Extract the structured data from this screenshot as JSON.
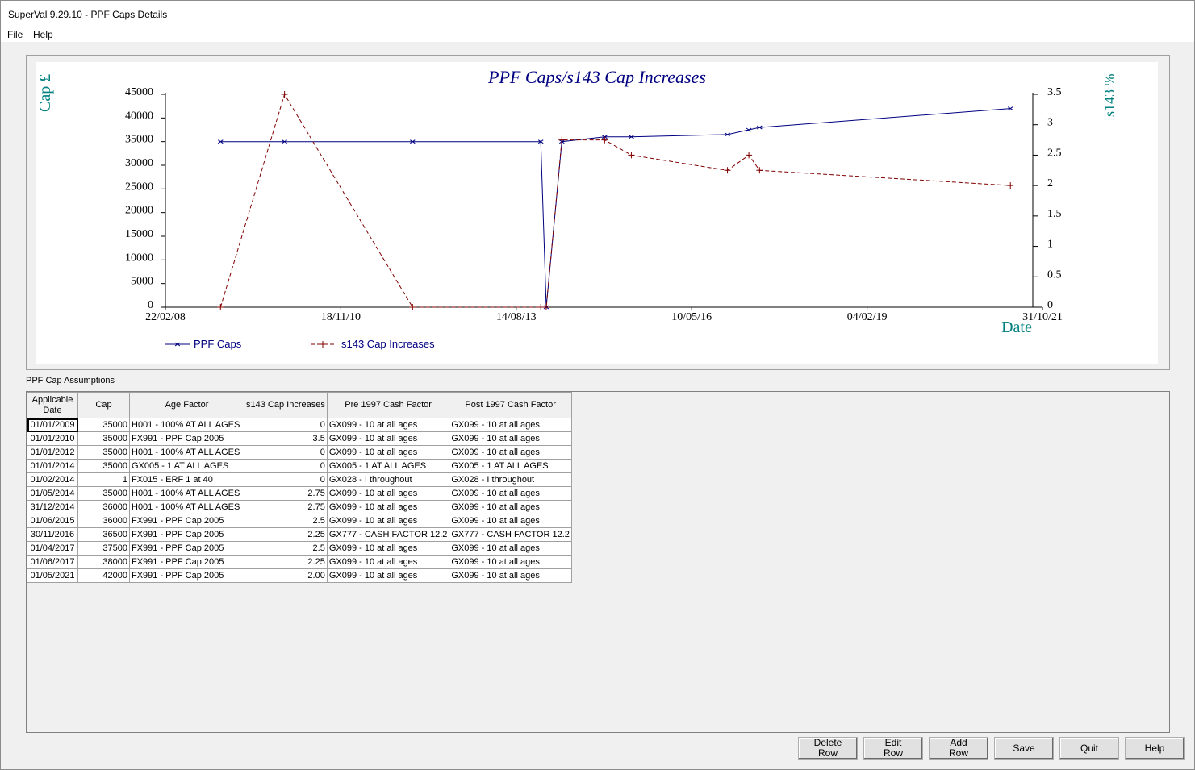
{
  "window": {
    "title": "SuperVal  9.29.10 - PPF Caps Details"
  },
  "menu": [
    "File",
    "Help"
  ],
  "chart_data": {
    "type": "line",
    "title": "PPF Caps/s143 Cap Increases",
    "ylabel": "Cap £",
    "y2label": "s143 %",
    "xlabel": "Date",
    "x_ticks": [
      "22/02/08",
      "18/11/10",
      "14/08/13",
      "10/05/16",
      "04/02/19",
      "31/10/21"
    ],
    "y_ticks": [
      "0",
      "5000",
      "10000",
      "15000",
      "20000",
      "25000",
      "30000",
      "35000",
      "40000",
      "45000"
    ],
    "y2_ticks": [
      "0",
      "0.5",
      "1",
      "1.5",
      "2",
      "2.5",
      "3",
      "3.5"
    ],
    "ylim": [
      0,
      45000
    ],
    "y2lim": [
      0,
      3.5
    ],
    "xlim": [
      "22/02/08",
      "31/10/21"
    ],
    "legend": "bottom-left",
    "series": [
      {
        "name": "PPF Caps",
        "axis": "left",
        "color": "#000080",
        "style": "solid",
        "x": [
          "01/01/2009",
          "01/01/2010",
          "01/01/2012",
          "01/01/2014",
          "01/02/2014",
          "01/05/2014",
          "31/12/2014",
          "01/06/2015",
          "30/11/2016",
          "01/04/2017",
          "01/06/2017",
          "01/05/2021"
        ],
        "values": [
          35000,
          35000,
          35000,
          35000,
          1,
          35000,
          36000,
          36000,
          36500,
          37500,
          38000,
          42000
        ]
      },
      {
        "name": "s143 Cap Increases",
        "axis": "right",
        "color": "#800000",
        "style": "dashed",
        "x": [
          "01/01/2009",
          "01/01/2010",
          "01/01/2012",
          "01/01/2014",
          "01/02/2014",
          "01/05/2014",
          "31/12/2014",
          "01/06/2015",
          "30/11/2016",
          "01/04/2017",
          "01/06/2017",
          "01/05/2021"
        ],
        "values": [
          0,
          3.5,
          0,
          0,
          0,
          2.75,
          2.75,
          2.5,
          2.25,
          2.5,
          2.25,
          2.0
        ]
      }
    ]
  },
  "table": {
    "label": "PPF Cap Assumptions",
    "columns": [
      "Applicable Date",
      "Cap",
      "Age Factor",
      "s143 Cap Increases",
      "Pre 1997 Cash Factor",
      "Post 1997 Cash Factor"
    ],
    "rows": [
      [
        "01/01/2009",
        "35000",
        "H001 - 100% AT ALL AGES",
        "0",
        "GX099 - 10 at all ages",
        "GX099 - 10 at all ages"
      ],
      [
        "01/01/2010",
        "35000",
        "FX991 - PPF Cap 2005",
        "3.5",
        "GX099 - 10 at all ages",
        "GX099 - 10 at all ages"
      ],
      [
        "01/01/2012",
        "35000",
        "H001 - 100% AT ALL AGES",
        "0",
        "GX099 - 10 at all ages",
        "GX099 - 10 at all ages"
      ],
      [
        "01/01/2014",
        "35000",
        "GX005 - 1 AT ALL AGES",
        "0",
        "GX005 - 1 AT ALL AGES",
        "GX005 - 1 AT ALL AGES"
      ],
      [
        "01/02/2014",
        "1",
        "FX015 - ERF 1 at 40",
        "0",
        "GX028 - I throughout",
        "GX028 - I throughout"
      ],
      [
        "01/05/2014",
        "35000",
        "H001 - 100% AT ALL AGES",
        "2.75",
        "GX099 - 10 at all ages",
        "GX099 - 10 at all ages"
      ],
      [
        "31/12/2014",
        "36000",
        "H001 - 100% AT ALL AGES",
        "2.75",
        "GX099 - 10 at all ages",
        "GX099 - 10 at all ages"
      ],
      [
        "01/06/2015",
        "36000",
        "FX991 - PPF Cap 2005",
        "2.5",
        "GX099 - 10 at all ages",
        "GX099 - 10 at all ages"
      ],
      [
        "30/11/2016",
        "36500",
        "FX991 - PPF Cap 2005",
        "2.25",
        "GX777 - CASH FACTOR 12.2",
        "GX777 - CASH FACTOR 12.2"
      ],
      [
        "01/04/2017",
        "37500",
        "FX991 - PPF Cap 2005",
        "2.5",
        "GX099 - 10 at all ages",
        "GX099 - 10 at all ages"
      ],
      [
        "01/06/2017",
        "38000",
        "FX991 - PPF Cap 2005",
        "2.25",
        "GX099 - 10 at all ages",
        "GX099 - 10 at all ages"
      ],
      [
        "01/05/2021",
        "42000",
        "FX991 - PPF Cap 2005",
        "2.00",
        "GX099 - 10 at all ages",
        "GX099 - 10 at all ages"
      ]
    ]
  },
  "buttons": [
    {
      "name": "delete-row-button",
      "label": "Delete\nRow"
    },
    {
      "name": "edit-row-button",
      "label": "Edit\nRow"
    },
    {
      "name": "add-row-button",
      "label": "Add\nRow"
    },
    {
      "name": "save-button",
      "label": "Save"
    },
    {
      "name": "quit-button",
      "label": "Quit"
    },
    {
      "name": "help-button",
      "label": "Help"
    }
  ]
}
